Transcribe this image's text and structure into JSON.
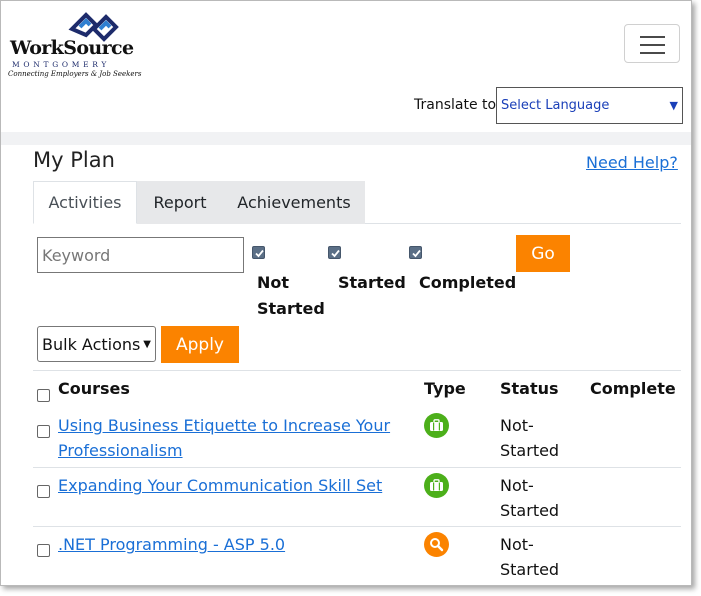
{
  "header": {
    "logo": {
      "brand": "WorkSource",
      "sub": "MONTGOMERY",
      "tagline": "Connecting Employers & Job Seekers"
    },
    "translate_label": "Translate to:",
    "language_select": "Select Language"
  },
  "page": {
    "title": "My Plan",
    "help_link": "Need Help?"
  },
  "tabs": [
    {
      "label": "Activities",
      "active": true
    },
    {
      "label": "Report",
      "active": false
    },
    {
      "label": "Achievements",
      "active": false
    }
  ],
  "filters": {
    "keyword_placeholder": "Keyword",
    "statuses": [
      {
        "label": "Not Started",
        "line1": "Not",
        "line2": "Started",
        "checked": true
      },
      {
        "label": "Started",
        "checked": true
      },
      {
        "label": "Completed",
        "checked": true
      }
    ],
    "go_label": "Go",
    "bulk_actions": "Bulk Actions",
    "apply_label": "Apply"
  },
  "table": {
    "headers": [
      "Courses",
      "Type",
      "Status",
      "Complete"
    ],
    "rows": [
      {
        "line1": "Using Business Etiquette to Increase Your",
        "line2": "Professionalism",
        "type": "briefcase-icon",
        "status1": "Not-",
        "status2": "Started",
        "complete": ""
      },
      {
        "line1": "Expanding Your Communication Skill Set",
        "line2": "",
        "type": "briefcase-icon",
        "status1": "Not-",
        "status2": "Started",
        "complete": ""
      },
      {
        "line1": ".NET Programming - ASP 5.0",
        "line2": "",
        "type": "search-icon",
        "status1": "Not-",
        "status2": "Started",
        "complete": ""
      }
    ]
  },
  "colors": {
    "accent_orange": "#fb8300",
    "link_blue": "#1a6fd6",
    "briefcase_green": "#4caf1a",
    "search_orange": "#fb8300"
  }
}
